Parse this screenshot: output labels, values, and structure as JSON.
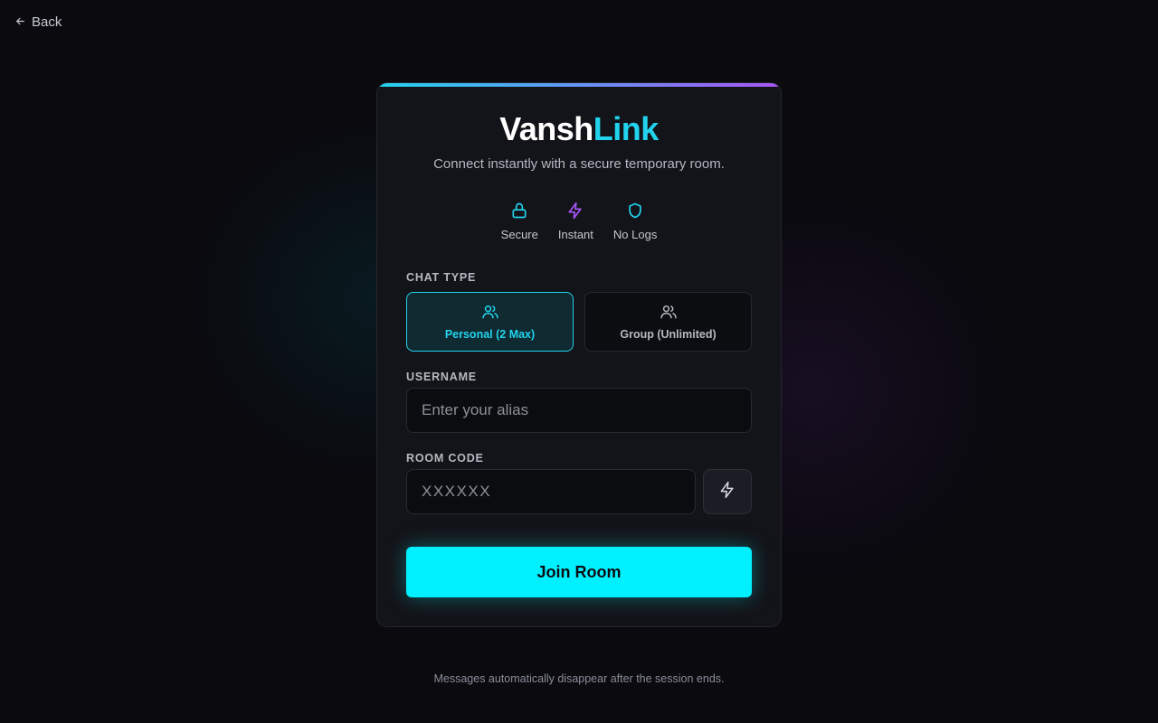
{
  "nav": {
    "back_label": "Back"
  },
  "brand": {
    "name_part1": "Vansh",
    "name_part2": "Link",
    "tagline": "Connect instantly with a secure temporary room."
  },
  "features": [
    {
      "icon": "lock-icon",
      "label": "Secure"
    },
    {
      "icon": "lightning-icon",
      "label": "Instant"
    },
    {
      "icon": "shield-icon",
      "label": "No Logs"
    }
  ],
  "chat_type": {
    "label": "CHAT TYPE",
    "options": [
      {
        "label": "Personal (2 Max)",
        "icon": "users-icon",
        "selected": true
      },
      {
        "label": "Group (Unlimited)",
        "icon": "users-icon",
        "selected": false
      }
    ]
  },
  "username": {
    "label": "USERNAME",
    "placeholder": "Enter your alias",
    "value": ""
  },
  "room_code": {
    "label": "ROOM CODE",
    "placeholder": "XXXXXX",
    "value": "",
    "generate_icon": "lightning-icon"
  },
  "join_button": {
    "label": "Join Room"
  },
  "footer": {
    "note": "Messages automatically disappear after the session ends."
  },
  "colors": {
    "accent_cyan": "#00f0ff",
    "accent_purple": "#a855f7",
    "background": "#0a0a0f",
    "card": "#131419"
  }
}
